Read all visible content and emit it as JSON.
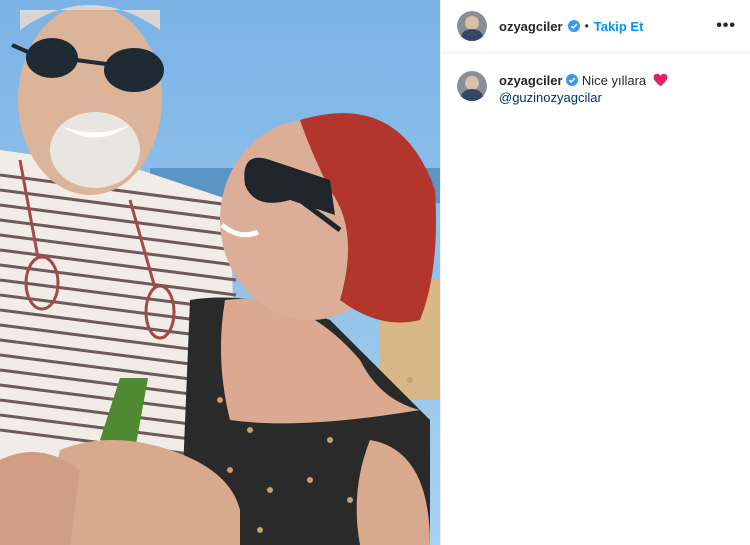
{
  "post": {
    "author": {
      "username": "ozyagciler",
      "verified": true,
      "follow_label": "Takip Et",
      "separator": "•",
      "more_label": "•••"
    },
    "caption": {
      "username": "ozyagciler",
      "verified": true,
      "text": "Nice yıllara",
      "emoji": "heart-emoji",
      "mention": "@guzinozyagcilar"
    },
    "photo": {
      "description_icon": "photo-content"
    }
  },
  "colors": {
    "accent": "#0095f6",
    "verified_badge": "#3897f0",
    "heart": "#e0245e",
    "mention": "#00376b"
  }
}
